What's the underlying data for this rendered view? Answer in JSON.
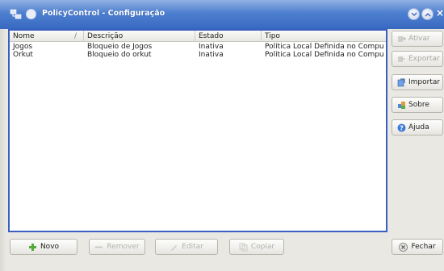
{
  "window": {
    "title": "PolicyControl - Configuração",
    "minimize_label": "",
    "close_label": "×"
  },
  "table": {
    "columns": [
      "Nome",
      "Descrição",
      "Estado",
      "Tipo"
    ],
    "sort_indicator": "/",
    "rows": [
      [
        "Jogos",
        "Bloqueio de Jogos",
        "Inativa",
        "Política Local Definida no Compu"
      ],
      [
        "Orkut",
        "Bloqueio do orkut",
        "Inativa",
        "Política Local Definida no Compu"
      ]
    ]
  },
  "side_buttons": {
    "ativar": "Ativar",
    "exportar": "Exportar",
    "importar": "Importar",
    "sobre": "Sobre",
    "ajuda": "Ajuda",
    "fechar": "Fechar"
  },
  "bottom_buttons": {
    "novo": "Novo",
    "remover": "Remover",
    "editar": "Editar",
    "copiar": "Copiar"
  },
  "colors": {
    "titlebar": "#4d7fd0",
    "list_border": "#3a5fc1",
    "disabled_text": "#a8a7a2"
  },
  "icons": {
    "app": "network-computers-icon",
    "ativar": "activate-icon",
    "exportar": "export-icon",
    "importar": "import-icon",
    "sobre": "puzzle-icon",
    "ajuda": "help-icon",
    "fechar": "close-icon",
    "novo": "add-icon",
    "remover": "remove-icon",
    "editar": "edit-icon",
    "copiar": "copy-icon"
  }
}
